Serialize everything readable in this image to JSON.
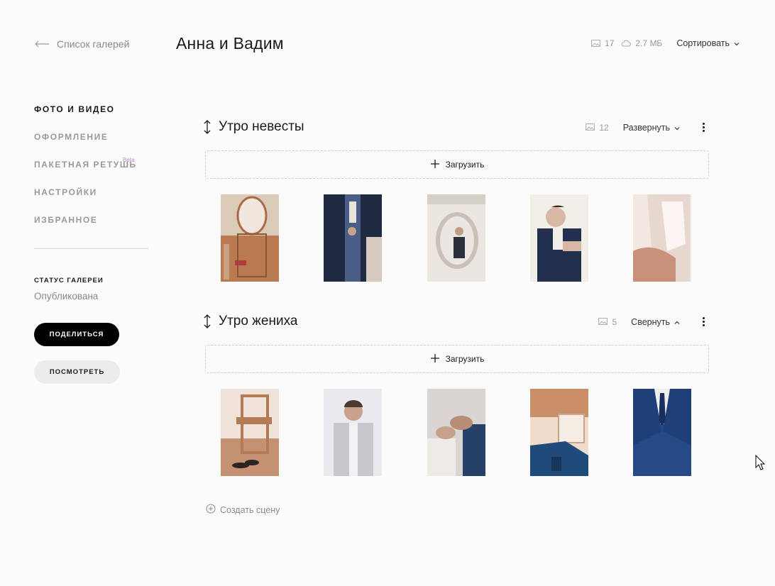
{
  "header": {
    "back_label": "Список галерей",
    "title": "Анна и Вадим",
    "photo_count": "17",
    "storage": "2.7 МБ",
    "sort_label": "Сортировать"
  },
  "sidebar": {
    "items": [
      {
        "label": "ФОТО И ВИДЕО",
        "active": true
      },
      {
        "label": "ОФОРМЛЕНИЕ",
        "active": false
      },
      {
        "label": "ПАКЕТНАЯ РЕТУШЬ",
        "active": false,
        "badge": "Beta"
      },
      {
        "label": "НАСТРОЙКИ",
        "active": false
      },
      {
        "label": "ИЗБРАННОЕ",
        "active": false
      }
    ],
    "status_label": "СТАТУС ГАЛЕРЕИ",
    "status_value": "Опубликована",
    "share_label": "ПОДЕЛИТЬСЯ",
    "view_label": "ПОСМОТРЕТЬ"
  },
  "scenes": [
    {
      "title": "Утро невесты",
      "count": "12",
      "toggle_label": "Развернуть",
      "upload_label": "Загрузить",
      "photos": [
        {
          "subject": "mirror-shoes",
          "colors": [
            "#a86a44",
            "#f1e6dc",
            "#c9a183"
          ]
        },
        {
          "subject": "groom-suit-buttons",
          "colors": [
            "#1e2a42",
            "#4a5d86",
            "#e8e2da"
          ]
        },
        {
          "subject": "mirror-reflection",
          "colors": [
            "#ece6e0",
            "#c9c0b8",
            "#2b2f3a"
          ]
        },
        {
          "subject": "groom-boutonniere",
          "colors": [
            "#22304e",
            "#d8b8a4",
            "#f2efe9"
          ]
        },
        {
          "subject": "bride-dress-lacing",
          "colors": [
            "#f3e7e1",
            "#c99179",
            "#e7d8cf"
          ]
        }
      ]
    },
    {
      "title": "Утро жениха",
      "count": "5",
      "toggle_label": "Свернуть",
      "upload_label": "Загрузить",
      "photos": [
        {
          "subject": "chair-shoes",
          "colors": [
            "#b37a55",
            "#f0e4da",
            "#2a2522"
          ]
        },
        {
          "subject": "groom-vest",
          "colors": [
            "#c7c7cd",
            "#eae9ee",
            "#4a3a34"
          ]
        },
        {
          "subject": "hands-cufflinks",
          "colors": [
            "#d8d5d2",
            "#254168",
            "#b98c75"
          ]
        },
        {
          "subject": "suit-on-bed",
          "colors": [
            "#c98f68",
            "#1f4a7a",
            "#f0dccb"
          ]
        },
        {
          "subject": "groom-blue-suit",
          "colors": [
            "#254a86",
            "#f0eeee",
            "#1a2f5c"
          ]
        }
      ]
    }
  ],
  "create_scene_label": "Создать сцену",
  "icons": {
    "back": "arrow-left-icon",
    "photos": "image-icon",
    "storage": "cloud-icon",
    "dropdown": "chevron-down-icon",
    "drag": "drag-handle-icon",
    "more": "kebab-menu-icon",
    "upload": "plus-icon",
    "create": "plus-circle-icon",
    "cursor": "mouse-pointer-icon"
  }
}
